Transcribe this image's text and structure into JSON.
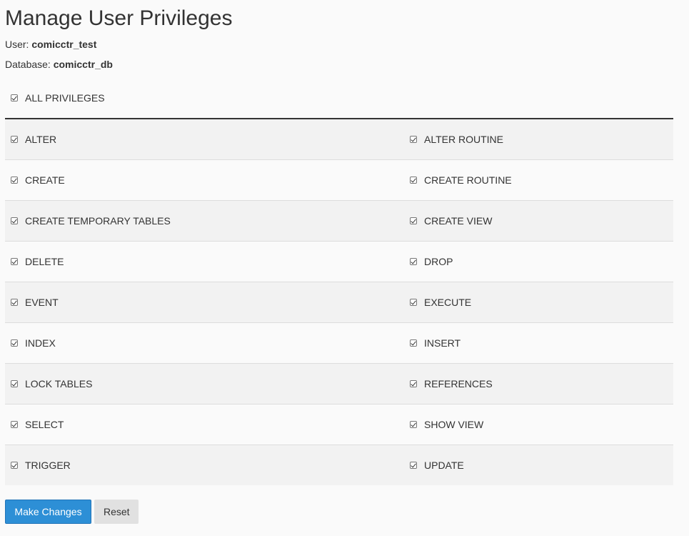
{
  "page": {
    "title": "Manage User Privileges"
  },
  "meta": {
    "user_label": "User:",
    "user_value": "comicctr_test",
    "database_label": "Database:",
    "database_value": "comicctr_db"
  },
  "all_privileges": {
    "label": "ALL PRIVILEGES",
    "checked": true
  },
  "privileges": [
    {
      "left": {
        "label": "ALTER",
        "checked": true
      },
      "right": {
        "label": "ALTER ROUTINE",
        "checked": true
      }
    },
    {
      "left": {
        "label": "CREATE",
        "checked": true
      },
      "right": {
        "label": "CREATE ROUTINE",
        "checked": true
      }
    },
    {
      "left": {
        "label": "CREATE TEMPORARY TABLES",
        "checked": true
      },
      "right": {
        "label": "CREATE VIEW",
        "checked": true
      }
    },
    {
      "left": {
        "label": "DELETE",
        "checked": true
      },
      "right": {
        "label": "DROP",
        "checked": true
      }
    },
    {
      "left": {
        "label": "EVENT",
        "checked": true
      },
      "right": {
        "label": "EXECUTE",
        "checked": true
      }
    },
    {
      "left": {
        "label": "INDEX",
        "checked": true
      },
      "right": {
        "label": "INSERT",
        "checked": true
      }
    },
    {
      "left": {
        "label": "LOCK TABLES",
        "checked": true
      },
      "right": {
        "label": "REFERENCES",
        "checked": true
      }
    },
    {
      "left": {
        "label": "SELECT",
        "checked": true
      },
      "right": {
        "label": "SHOW VIEW",
        "checked": true
      }
    },
    {
      "left": {
        "label": "TRIGGER",
        "checked": true
      },
      "right": {
        "label": "UPDATE",
        "checked": true
      }
    }
  ],
  "buttons": {
    "make_changes": "Make Changes",
    "reset": "Reset"
  },
  "colors": {
    "primary_button": "#2d8fd6",
    "default_button": "#e1e1e1",
    "row_stripe": "#f2f2f2",
    "background": "#fafafa"
  }
}
